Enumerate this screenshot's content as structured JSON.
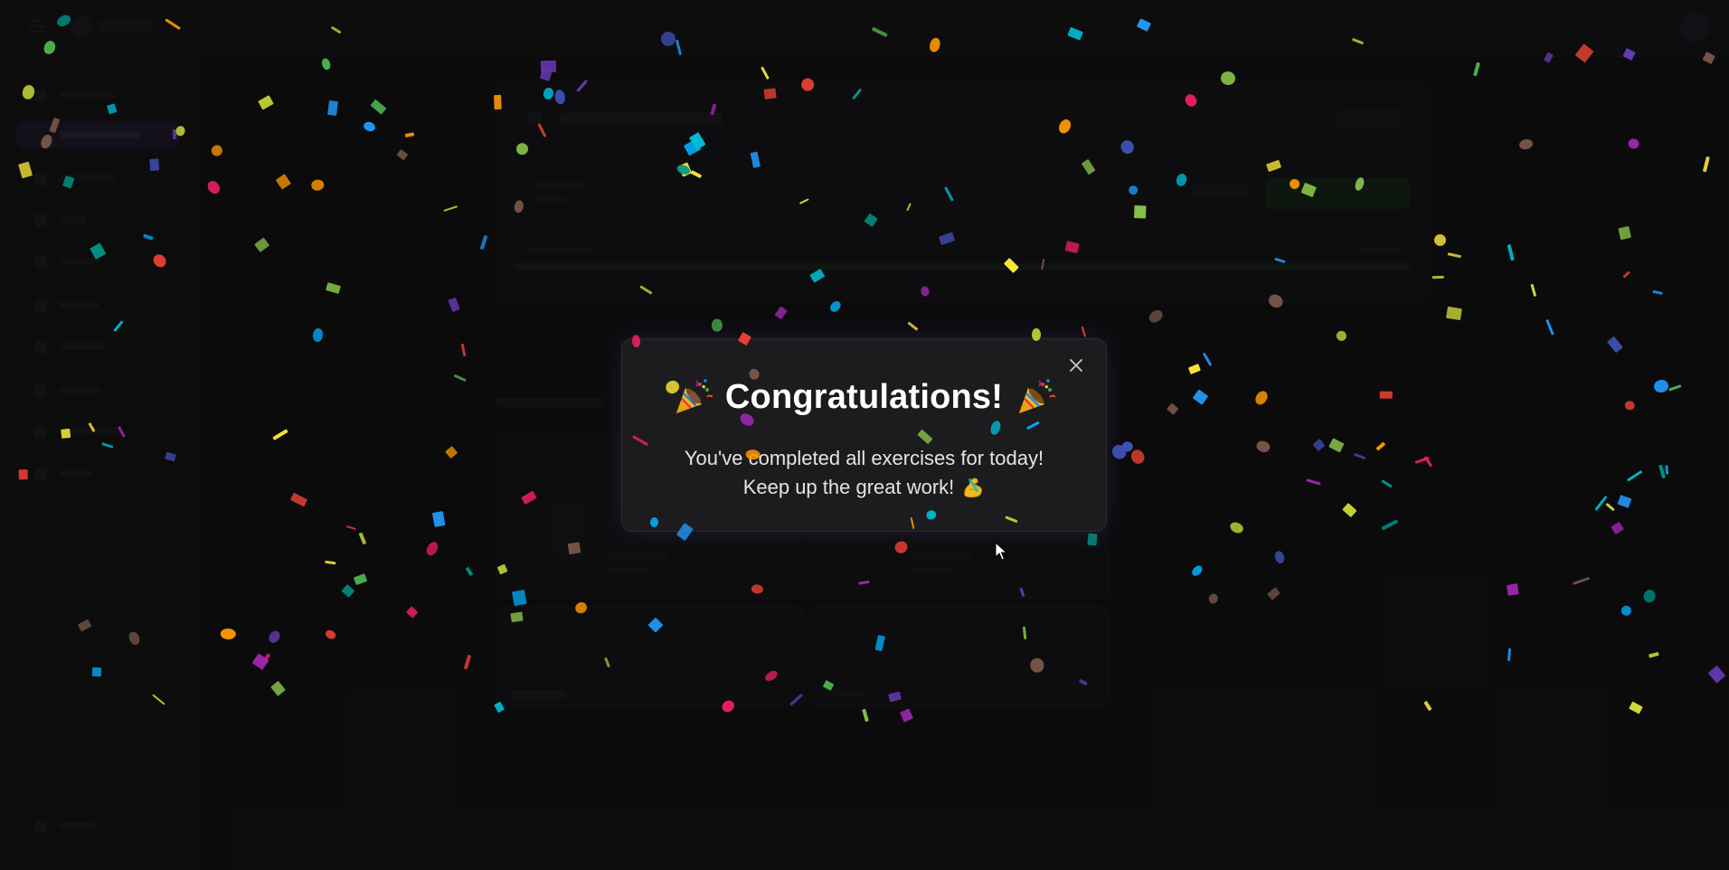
{
  "modal": {
    "title": "Congratulations!",
    "message_line1": "You've completed all exercises for today!",
    "message_line2": "Keep up the great work!",
    "title_icon": "party-popper-icon",
    "message_icon": "flexed-biceps-icon",
    "close_icon": "close-icon"
  },
  "colors": {
    "background": "#121213",
    "modal_background": "#1c1c1e",
    "modal_border": "#2d2838",
    "title_text": "#ffffff",
    "message_text": "#e4e4e6"
  },
  "confetti_palette": [
    "#e91e63",
    "#f44336",
    "#ff9800",
    "#ffeb3b",
    "#cddc39",
    "#8bc34a",
    "#4caf50",
    "#009688",
    "#00bcd4",
    "#03a9f4",
    "#2196f3",
    "#3f51b5",
    "#673ab7",
    "#9c27b0",
    "#795548"
  ]
}
